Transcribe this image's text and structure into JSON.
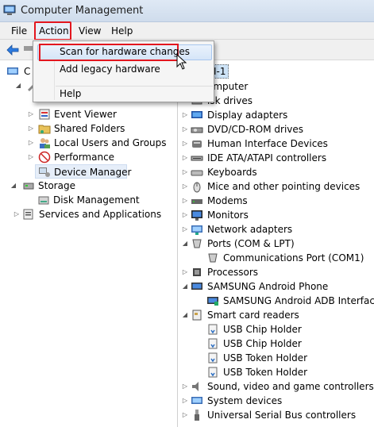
{
  "window": {
    "title": "Computer Management"
  },
  "menu": {
    "file": "File",
    "action": "Action",
    "view": "View",
    "help": "Help"
  },
  "action_menu": {
    "items": [
      "Scan for hardware changes",
      "Add legacy hardware",
      "Help"
    ],
    "highlighted": "Scan for hardware changes"
  },
  "left_tree": {
    "items": [
      {
        "label": "Event Viewer",
        "icon": "event-viewer-icon"
      },
      {
        "label": "Shared Folders",
        "icon": "shared-folders-icon"
      },
      {
        "label": "Local Users and Groups",
        "icon": "users-icon"
      },
      {
        "label": "Performance",
        "icon": "performance-icon"
      },
      {
        "label": "Device Manager",
        "icon": "device-manager-icon"
      },
      {
        "label": "Storage",
        "icon": "storage-icon"
      },
      {
        "label": "Disk Management",
        "icon": "disk-icon"
      },
      {
        "label": "Services and Applications",
        "icon": "services-icon"
      }
    ]
  },
  "right_tree": {
    "root": "I-1",
    "items": [
      {
        "label": "omputer",
        "icon": "computer-icon"
      },
      {
        "label": "isk drives",
        "icon": "disk-drive-icon"
      },
      {
        "label": "Display adapters",
        "icon": "display-icon"
      },
      {
        "label": "DVD/CD-ROM drives",
        "icon": "dvd-icon"
      },
      {
        "label": "Human Interface Devices",
        "icon": "hid-icon"
      },
      {
        "label": "IDE ATA/ATAPI controllers",
        "icon": "ide-icon"
      },
      {
        "label": "Keyboards",
        "icon": "keyboard-icon"
      },
      {
        "label": "Mice and other pointing devices",
        "icon": "mouse-icon"
      },
      {
        "label": "Modems",
        "icon": "modem-icon"
      },
      {
        "label": "Monitors",
        "icon": "monitor-icon"
      },
      {
        "label": "Network adapters",
        "icon": "network-icon"
      },
      {
        "label": "Ports (COM & LPT)",
        "icon": "ports-icon"
      },
      {
        "label": "Communications Port (COM1)",
        "icon": "port-icon"
      },
      {
        "label": "Processors",
        "icon": "processor-icon"
      },
      {
        "label": "SAMSUNG Android Phone",
        "icon": "phone-icon"
      },
      {
        "label": "SAMSUNG Android ADB Interface",
        "icon": "adb-icon"
      },
      {
        "label": "Smart card readers",
        "icon": "smartcard-icon"
      },
      {
        "label": "USB Chip Holder",
        "icon": "usb-device-icon"
      },
      {
        "label": "USB Chip Holder",
        "icon": "usb-device-icon"
      },
      {
        "label": "USB Token Holder",
        "icon": "usb-device-icon"
      },
      {
        "label": "USB Token Holder",
        "icon": "usb-device-icon"
      },
      {
        "label": "Sound, video and game controllers",
        "icon": "sound-icon"
      },
      {
        "label": "System devices",
        "icon": "system-icon"
      },
      {
        "label": "Universal Serial Bus controllers",
        "icon": "usb-icon"
      }
    ]
  },
  "colors": {
    "highlight_red": "#e3161e",
    "selection_blue": "#d5e5f8"
  }
}
